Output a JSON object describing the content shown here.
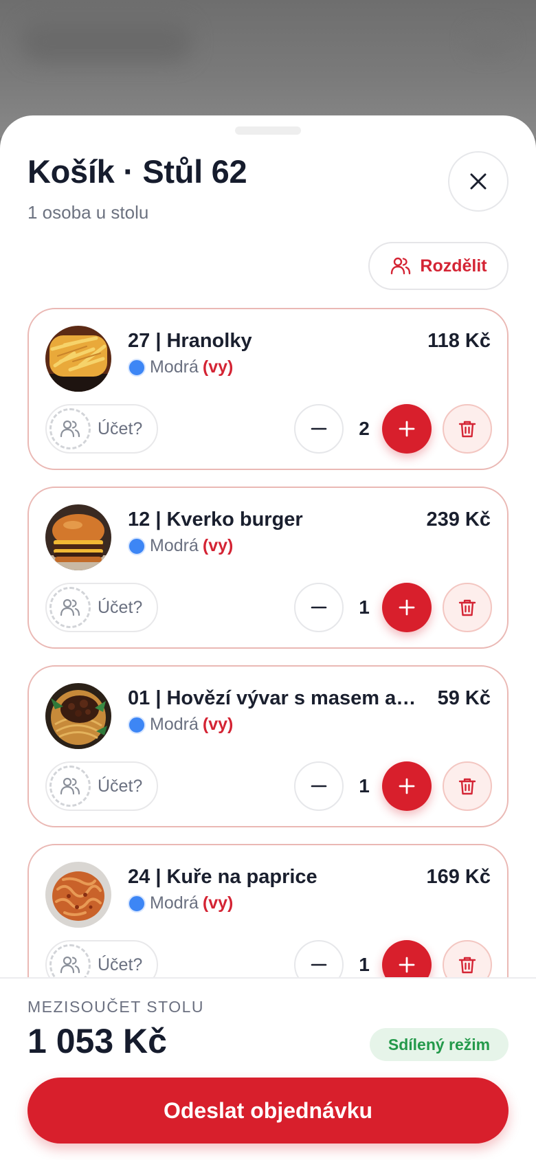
{
  "header": {
    "title": "Košík · Stůl 62",
    "subtitle": "1 osoba u stolu",
    "split_label": "Rozdělit"
  },
  "items": [
    {
      "name": "27 | Hranolky",
      "price": "118 Kč",
      "owner": "Modrá",
      "owner_you": "(vy)",
      "bill_label": "Účet?",
      "quantity": "2",
      "image": "fries"
    },
    {
      "name": "12 | Kverko burger",
      "price": "239 Kč",
      "owner": "Modrá",
      "owner_you": "(vy)",
      "bill_label": "Účet?",
      "quantity": "1",
      "image": "burger"
    },
    {
      "name": "01 | Hovězí vývar s masem a …",
      "price": "59 Kč",
      "owner": "Modrá",
      "owner_you": "(vy)",
      "bill_label": "Účet?",
      "quantity": "1",
      "image": "beef-noodles"
    },
    {
      "name": "24 | Kuře na paprice",
      "price": "169 Kč",
      "owner": "Modrá",
      "owner_you": "(vy)",
      "bill_label": "Účet?",
      "quantity": "1",
      "image": "chicken-paprika"
    }
  ],
  "footer": {
    "subtotal_label": "MEZISOUČET STOLU",
    "subtotal_value": "1 053 Kč",
    "mode_badge": "Sdílený režim",
    "submit_label": "Odeslat objednávku"
  },
  "colors": {
    "accent": "#d81f2c",
    "owner_dot": "#3d86f5",
    "badge_bg": "#e6f4e9",
    "badge_text": "#23994a"
  }
}
